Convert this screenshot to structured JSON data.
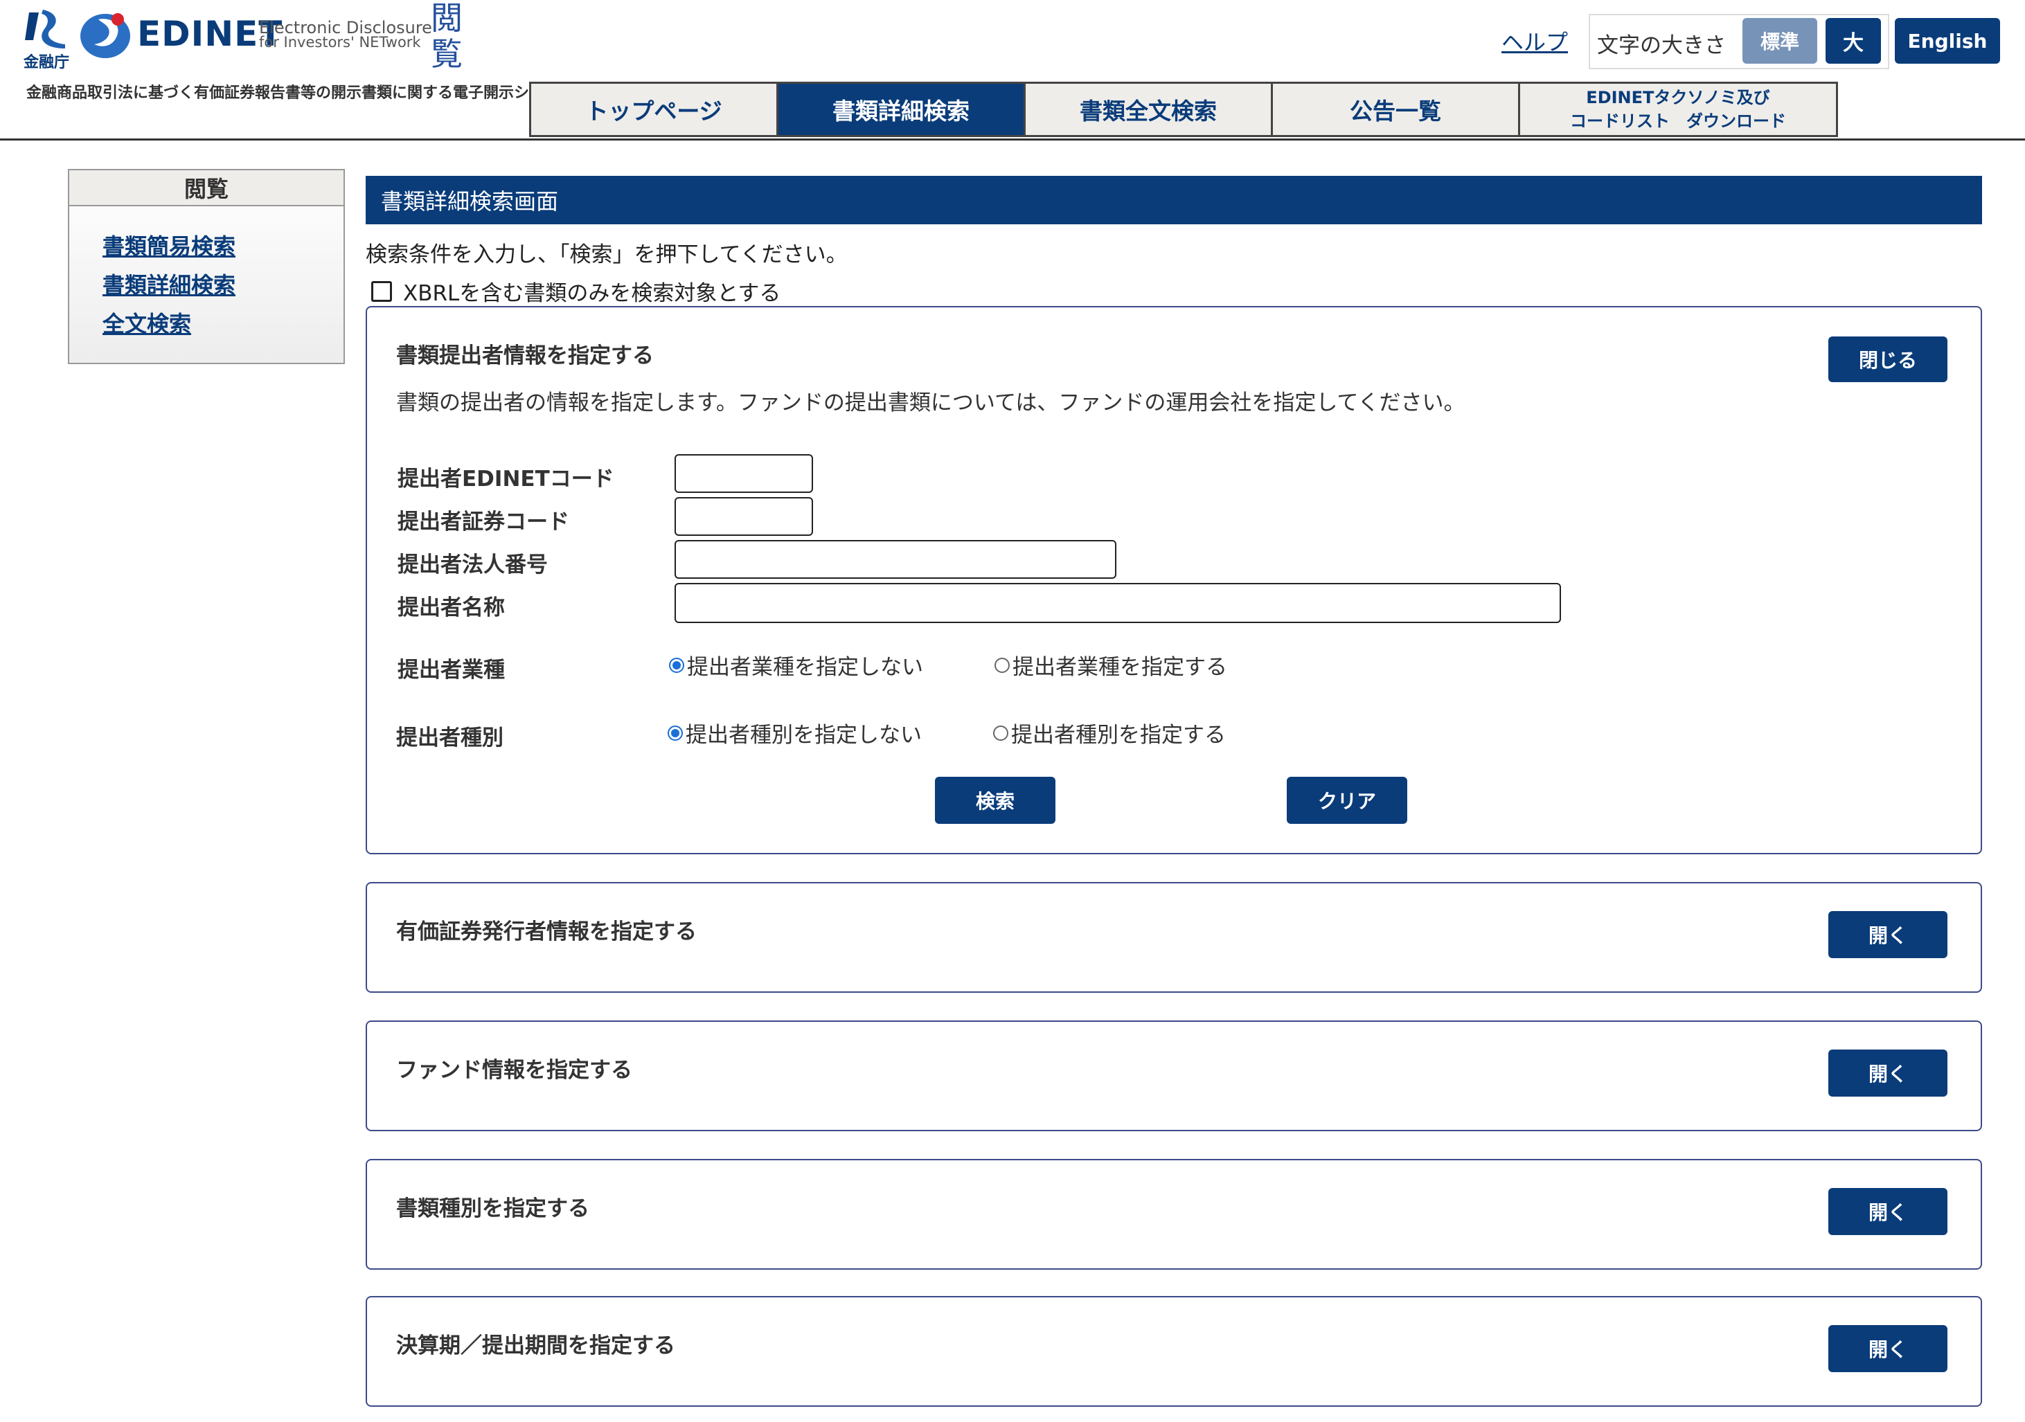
{
  "header": {
    "fsa_label": "金融庁",
    "edinet_word": "EDINET",
    "edinet_sub_line1": "Electronic Disclosure",
    "edinet_sub_line2": "for Investors' NETwork",
    "etsuran": "閲覧",
    "tagline": "金融商品取引法に基づく有価証券報告書等の開示書類に関する電子開示システム",
    "help": "ヘルプ",
    "font_size_label": "文字の大きさ",
    "font_standard": "標準",
    "font_large": "大",
    "english": "English"
  },
  "nav": {
    "tabs": [
      {
        "label": "トップページ",
        "active": false
      },
      {
        "label": "書類詳細検索",
        "active": true
      },
      {
        "label": "書類全文検索",
        "active": false
      },
      {
        "label": "公告一覧",
        "active": false
      },
      {
        "label": "EDINETタクソノミ及び\nコードリスト　ダウンロード",
        "active": false
      }
    ]
  },
  "sidebar": {
    "title": "閲覧",
    "items": [
      "書類簡易検索",
      "書類詳細検索",
      "全文検索"
    ]
  },
  "main": {
    "title": "書類詳細検索画面",
    "instruction": "検索条件を入力し、「検索」を押下してください。",
    "xbrl_only": "XBRLを含む書類のみを検索対象とする",
    "filer_panel": {
      "title": "書類提出者情報を指定する",
      "close_button": "閉じる",
      "description": "書類の提出者の情報を指定します。ファンドの提出書類については、ファンドの運用会社を指定してください。",
      "fields": {
        "edinet_code": {
          "label": "提出者EDINETコード",
          "value": ""
        },
        "securities_code": {
          "label": "提出者証券コード",
          "value": ""
        },
        "corporate_number": {
          "label": "提出者法人番号",
          "value": ""
        },
        "name": {
          "label": "提出者名称",
          "value": ""
        }
      },
      "industry": {
        "label": "提出者業種",
        "options": [
          "提出者業種を指定しない",
          "提出者業種を指定する"
        ],
        "selected": "提出者業種を指定しない"
      },
      "type": {
        "label": "提出者種別",
        "options": [
          "提出者種別を指定しない",
          "提出者種別を指定する"
        ],
        "selected": "提出者種別を指定しない"
      },
      "search_button": "検索",
      "clear_button": "クリア"
    },
    "collapsed_panels": [
      {
        "title": "有価証券発行者情報を指定する",
        "button": "開く"
      },
      {
        "title": "ファンド情報を指定する",
        "button": "開く"
      },
      {
        "title": "書類種別を指定する",
        "button": "開く"
      },
      {
        "title": "決算期／提出期間を指定する",
        "button": "開く"
      }
    ]
  },
  "colors": {
    "brand_navy": "#0a3c7a",
    "standard_button": "#7893b8",
    "panel_border": "#3d4a8a",
    "radio_selected": "#1a6fd8"
  }
}
